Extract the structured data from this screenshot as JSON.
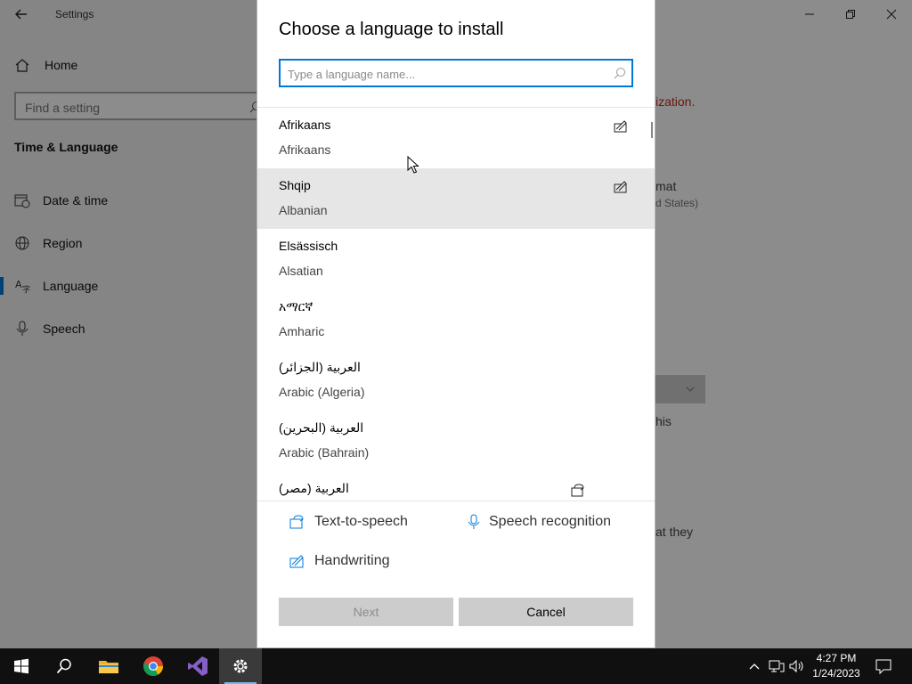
{
  "settings_window": {
    "title": "Settings",
    "home_label": "Home",
    "find_placeholder": "Find a setting",
    "section_title": "Time & Language",
    "nav": [
      {
        "label": "Date & time",
        "icon": "calendar-clock-icon"
      },
      {
        "label": "Region",
        "icon": "globe-icon"
      },
      {
        "label": "Language",
        "icon": "language-icon",
        "selected": true
      },
      {
        "label": "Speech",
        "icon": "microphone-icon"
      }
    ],
    "background_fragments": {
      "red_text": "ization.",
      "format_text": "mat",
      "states_text": "d States)",
      "this_text": "his",
      "they_text": "at they"
    }
  },
  "dialog": {
    "title": "Choose a language to install",
    "search": {
      "placeholder": "Type a language name...",
      "value": ""
    },
    "languages": [
      {
        "native": "Afrikaans",
        "english": "Afrikaans",
        "feature_icon": "handwriting-icon"
      },
      {
        "native": "Shqip",
        "english": "Albanian",
        "feature_icon": "handwriting-icon"
      },
      {
        "native": "Elsässisch",
        "english": "Alsatian",
        "feature_icon": ""
      },
      {
        "native": "አማርኛ",
        "english": "Amharic",
        "feature_icon": ""
      },
      {
        "native": "العربية (الجزائر)",
        "english": "Arabic (Algeria)",
        "feature_icon": ""
      },
      {
        "native": "العربية (البحرين)",
        "english": "Arabic (Bahrain)",
        "feature_icon": ""
      },
      {
        "native": "العربية (مصر)",
        "english": "",
        "feature_icon": "text-to-speech-icon"
      }
    ],
    "legend": {
      "text_to_speech": "Text-to-speech",
      "speech_recognition": "Speech recognition",
      "handwriting": "Handwriting"
    },
    "buttons": {
      "next": "Next",
      "cancel": "Cancel"
    }
  },
  "taskbar": {
    "apps": [
      "start-icon",
      "search-icon",
      "file-explorer-icon",
      "chrome-icon",
      "visual-studio-icon",
      "settings-gear-icon"
    ],
    "clock": {
      "time": "4:27 PM",
      "date": "1/24/2023"
    }
  },
  "colors": {
    "accent": "#0078d7",
    "overlay": "#000000",
    "error_red": "#c42b1c"
  }
}
